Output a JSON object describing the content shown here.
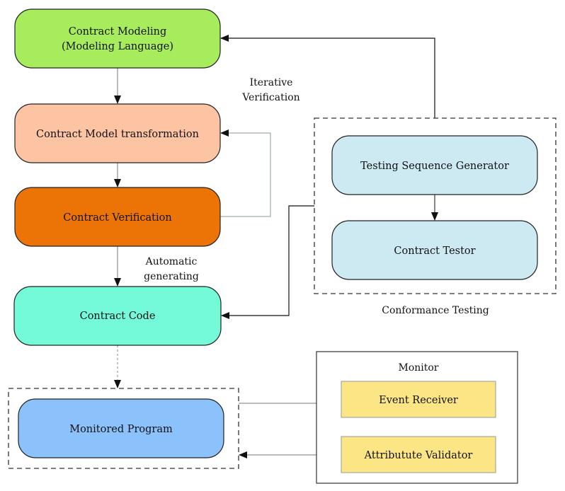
{
  "nodes": {
    "contract_modeling": {
      "line1": "Contract Modeling",
      "line2": "(Modeling Language)",
      "color": "#a6ec5c"
    },
    "model_transformation": {
      "label": "Contract Model transformation",
      "color": "#fdc4a4"
    },
    "contract_verification": {
      "label": "Contract Verification",
      "color": "#ec7305"
    },
    "contract_code": {
      "label": "Contract Code",
      "color": "#74fad9"
    },
    "monitored_program": {
      "label": "Monitored Program",
      "color": "#8bc2fb"
    },
    "testing_sequence_generator": {
      "label": "Testing Sequence Generator",
      "color": "#cde9f2"
    },
    "contract_testor": {
      "label": "Contract Testor",
      "color": "#cde9f2"
    },
    "event_receiver": {
      "label": "Event Receiver",
      "color": "#fce584"
    },
    "attribute_validator": {
      "label": "Attributute Validator",
      "color": "#fce584"
    }
  },
  "groups": {
    "conformance_testing": {
      "label": "Conformance Testing"
    },
    "monitor": {
      "label": "Monitor"
    }
  },
  "edge_labels": {
    "iterative_verification": {
      "line1": "Iterative",
      "line2": "Verification"
    },
    "automatic_generating": {
      "line1": "Automatic",
      "line2": "generating"
    }
  }
}
